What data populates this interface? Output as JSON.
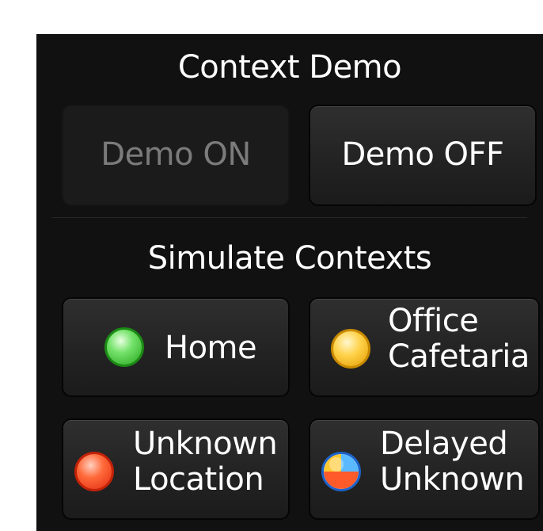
{
  "context_demo": {
    "title": "Context Demo",
    "demo_on_label": "Demo ON",
    "demo_off_label": "Demo OFF",
    "demo_on_enabled": false
  },
  "simulate": {
    "title": "Simulate Contexts",
    "buttons": [
      {
        "line1": "Home",
        "icon": "green-circle-icon",
        "color": "#4ccf40"
      },
      {
        "line1": "Office",
        "line2": "Cafetaria",
        "icon": "yellow-circle-icon",
        "color": "#ffc832"
      },
      {
        "line1": "Unknown",
        "line2": "Location",
        "icon": "red-circle-icon",
        "color": "#ff4a24"
      },
      {
        "line1": "Delayed",
        "line2": "Unknown",
        "icon": "multicolor-circle-icon",
        "colors": [
          "#ff5a2a",
          "#ffc832",
          "#5bbaff"
        ]
      }
    ]
  }
}
